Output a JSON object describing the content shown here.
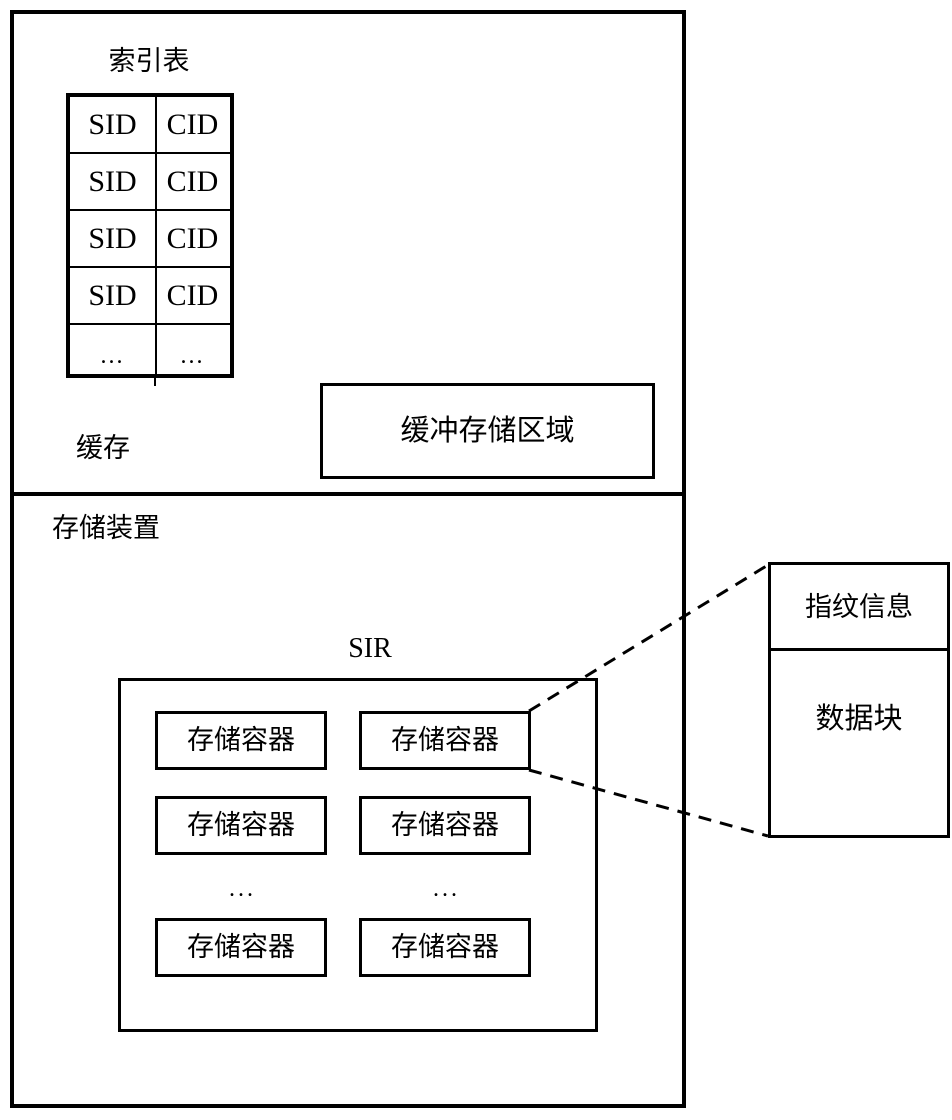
{
  "diagram": {
    "cache_region": {
      "label": "缓存",
      "index_table": {
        "title": "索引表",
        "columns": [
          "SID",
          "CID"
        ],
        "rows": [
          {
            "sid": "SID",
            "cid": "CID"
          },
          {
            "sid": "SID",
            "cid": "CID"
          },
          {
            "sid": "SID",
            "cid": "CID"
          },
          {
            "sid": "SID",
            "cid": "CID"
          },
          {
            "sid": "...",
            "cid": "..."
          }
        ]
      },
      "buffer_area": {
        "label": "缓冲存储区域"
      }
    },
    "storage_device_region": {
      "label": "存储装置",
      "sir": {
        "title": "SIR",
        "container_label": "存储容器",
        "containers": [
          {
            "label": "存储容器"
          },
          {
            "label": "存储容器"
          },
          {
            "label": "存储容器"
          },
          {
            "label": "存储容器"
          },
          {
            "label": "存储容器"
          },
          {
            "label": "存储容器"
          }
        ],
        "ellipsis_left": "...",
        "ellipsis_right": "..."
      }
    },
    "callout": {
      "fingerprint_label": "指纹信息",
      "data_block_label": "数据块"
    },
    "colors": {
      "stroke": "#000000",
      "background": "#ffffff"
    }
  }
}
